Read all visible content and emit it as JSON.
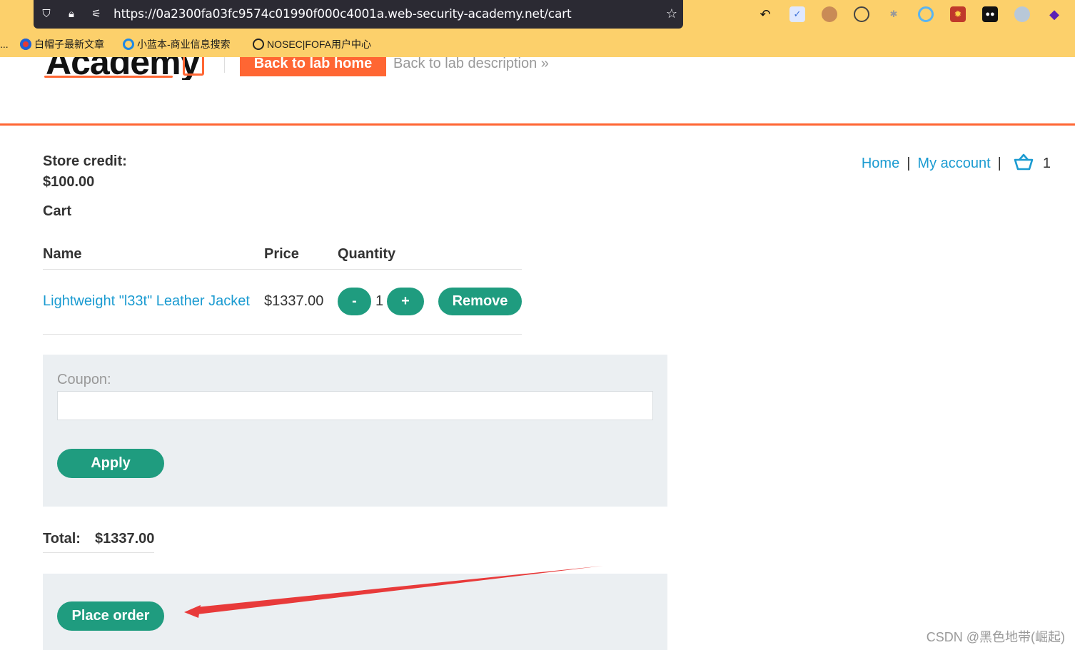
{
  "browser": {
    "url": "https://0a2300fa03fc9574c01990f000c4001a.web-security-academy.net/cart",
    "bookmarks": [
      {
        "label": "白帽子最新文章"
      },
      {
        "label": "小蓝本-商业信息搜索"
      },
      {
        "label": "NOSEC|FOFA用户中心"
      }
    ],
    "bookmarks_overflow": "..."
  },
  "lab_header": {
    "logo_text": "Academy",
    "back_button": "Back to lab home",
    "back_description": "Back to lab description"
  },
  "nav": {
    "home": "Home",
    "separator": "|",
    "my_account": "My account",
    "cart_count": "1"
  },
  "store_credit": {
    "label": "Store credit:",
    "value": "$100.00"
  },
  "cart": {
    "heading": "Cart",
    "columns": [
      "Name",
      "Price",
      "Quantity"
    ],
    "items": [
      {
        "name": "Lightweight \"l33t\" Leather Jacket",
        "price": "$1337.00",
        "quantity": "1",
        "decrease": "-",
        "increase": "+",
        "remove": "Remove"
      }
    ]
  },
  "coupon": {
    "label": "Coupon:",
    "value": "",
    "apply": "Apply"
  },
  "total": {
    "label": "Total:",
    "value": "$1337.00"
  },
  "place_order": "Place order",
  "annotation": {
    "arrow_color": "#e83a3a"
  },
  "watermark": "CSDN @黑色地带(崛起)",
  "colors": {
    "chrome": "#fcd06b",
    "accent_orange": "#ff6633",
    "button_green": "#1f9c7f",
    "link_blue": "#1b9bd1",
    "panel_grey": "#ebeff2"
  }
}
